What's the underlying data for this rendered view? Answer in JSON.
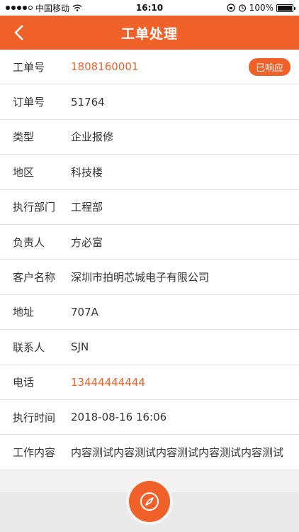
{
  "statusbar": {
    "carrier": "中国移动",
    "time": "16:10",
    "battery": "100%"
  },
  "navbar": {
    "title": "工单处理"
  },
  "order": {
    "badge": "已响应",
    "rows": [
      {
        "label": "工单号",
        "value": "1808160001"
      },
      {
        "label": "订单号",
        "value": "51764"
      },
      {
        "label": "类型",
        "value": "企业报修"
      },
      {
        "label": "地区",
        "value": "科技楼"
      },
      {
        "label": "执行部门",
        "value": "工程部"
      },
      {
        "label": "负责人",
        "value": "方必富"
      },
      {
        "label": "客户名称",
        "value": "深圳市拍明芯城电子有限公司"
      },
      {
        "label": "地址",
        "value": "707A"
      },
      {
        "label": "联系人",
        "value": "SJN"
      },
      {
        "label": "电话",
        "value": "13444444444"
      },
      {
        "label": "执行时间",
        "value": "2018-08-16 16:06"
      },
      {
        "label": "工作内容",
        "value": "内容测试内容测试内容测试内容测试内容测试"
      }
    ]
  },
  "colors": {
    "accent": "#f0612a"
  },
  "icons": {
    "back": "chevron-left-icon",
    "fab": "compass-icon"
  }
}
